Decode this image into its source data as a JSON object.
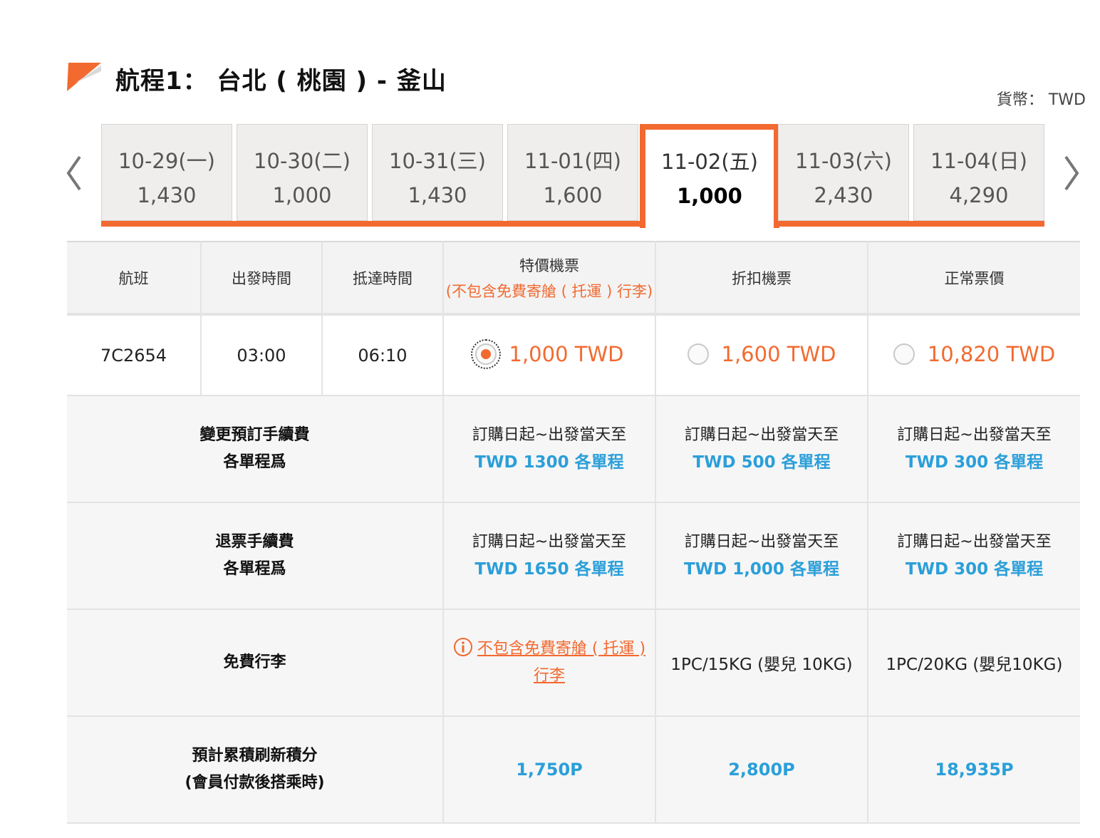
{
  "header": {
    "title": "航程1： 台北 ( 桃園 ) - 釜山",
    "currency": "貨幣： TWD"
  },
  "dates": [
    {
      "date": "10-29(一)",
      "price": "1,430",
      "active": false
    },
    {
      "date": "10-30(二)",
      "price": "1,000",
      "active": false
    },
    {
      "date": "10-31(三)",
      "price": "1,430",
      "active": false
    },
    {
      "date": "11-01(四)",
      "price": "1,600",
      "active": false
    },
    {
      "date": "11-02(五)",
      "price": "1,000",
      "active": true
    },
    {
      "date": "11-03(六)",
      "price": "2,430",
      "active": false
    },
    {
      "date": "11-04(日)",
      "price": "4,290",
      "active": false
    }
  ],
  "table": {
    "headers": {
      "flight": "航班",
      "depart": "出發時間",
      "arrive": "抵達時間",
      "special": "特價機票",
      "special_note": "(不包含免費寄艙 ( 托運 ) 行李)",
      "discount": "折扣機票",
      "normal": "正常票價"
    },
    "flight": {
      "number": "7C2654",
      "depart": "03:00",
      "arrive": "06:10",
      "special_price": "1,000 TWD",
      "discount_price": "1,600 TWD",
      "normal_price": "10,820 TWD"
    },
    "change_fee": {
      "label_1": "變更預訂手續費",
      "label_2": "各單程爲",
      "special_1": "訂購日起~出發當天至",
      "special_2": "TWD 1300 各單程",
      "discount_1": "訂購日起~出發當天至",
      "discount_2": "TWD 500 各單程",
      "normal_1": "訂購日起~出發當天至",
      "normal_2": "TWD 300 各單程"
    },
    "refund_fee": {
      "label_1": "退票手續費",
      "label_2": "各單程爲",
      "special_1": "訂購日起~出發當天至",
      "special_2": "TWD 1650 各單程",
      "discount_1": "訂購日起~出發當天至",
      "discount_2": "TWD 1,000 各單程",
      "normal_1": "訂購日起~出發當天至",
      "normal_2": "TWD 300 各單程"
    },
    "baggage": {
      "label": "免費行李",
      "special_1": "不包含免費寄艙 ( 托運 )",
      "special_2": "行李",
      "discount": "1PC/15KG (嬰兒 10KG)",
      "normal": "1PC/20KG (嬰兒10KG)"
    },
    "points": {
      "label_1": "預計累積刷新積分",
      "label_2": "(會員付款後搭乘時)",
      "special": "1,750P",
      "discount": "2,800P",
      "normal": "18,935P"
    }
  },
  "colors": {
    "accent": "#f26a30",
    "link_blue": "#2b9fd9"
  }
}
